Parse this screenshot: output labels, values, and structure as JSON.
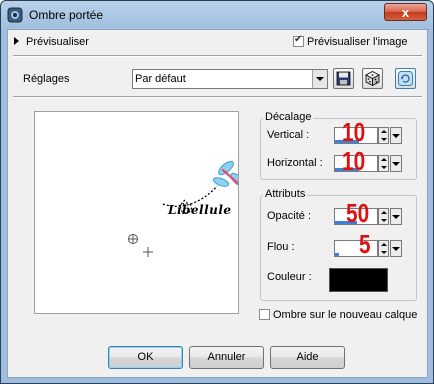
{
  "window": {
    "title": "Ombre portée",
    "close_label": "x"
  },
  "preview_row": {
    "label": "Prévisualiser",
    "checkbox_label": "Prévisualiser l'image",
    "checked": true
  },
  "settings": {
    "label": "Réglages",
    "preset_value": "Par défaut"
  },
  "preview": {
    "watermark": "Libellule"
  },
  "offset_group": {
    "title": "Décalage",
    "vertical_label": "Vertical :",
    "vertical_value": "10",
    "horizontal_label": "Horizontal :",
    "horizontal_value": "10"
  },
  "attributes_group": {
    "title": "Attributs",
    "opacity_label": "Opacité :",
    "opacity_value": "50",
    "blur_label": "Flou :",
    "blur_value": "5",
    "color_label": "Couleur :",
    "color": "#000000"
  },
  "new_layer": {
    "label": "Ombre sur le nouveau calque",
    "checked": false
  },
  "buttons": {
    "ok": "OK",
    "cancel": "Annuler",
    "help": "Aide"
  },
  "colors": {
    "accent_number": "#e01010",
    "spin_fill": "#3f7fd7",
    "chrome": "#9fbdde"
  }
}
